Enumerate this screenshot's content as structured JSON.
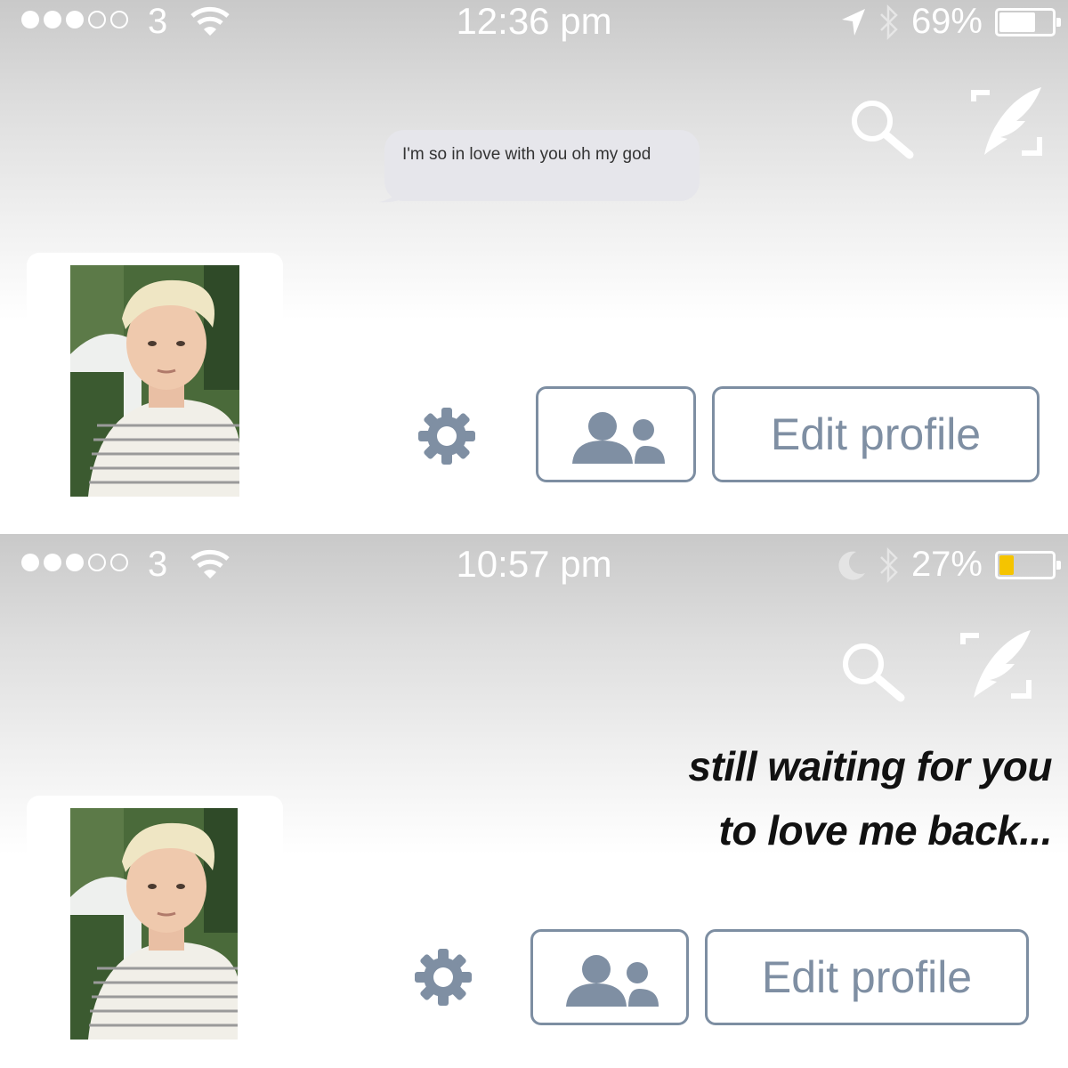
{
  "screens": [
    {
      "status": {
        "carrier": "3",
        "time": "12:36 pm",
        "battery_percent": "69%",
        "battery_level": 0.69,
        "battery_color": "#ffffff",
        "signal_bars": 3,
        "left_indicator": "location-arrow-icon"
      },
      "message": "I'm so in love with you oh my god",
      "buttons": {
        "edit_profile": "Edit profile"
      }
    },
    {
      "status": {
        "carrier": "3",
        "time": "10:57 pm",
        "battery_percent": "27%",
        "battery_level": 0.27,
        "battery_color": "#f5c400",
        "signal_bars": 3,
        "left_indicator": "moon-icon"
      },
      "caption": {
        "line1": "still waiting for you",
        "line2": "to love me back..."
      },
      "buttons": {
        "edit_profile": "Edit profile"
      }
    }
  ],
  "icons": {
    "search": "search-icon",
    "compose": "compose-feather-icon",
    "settings": "gear-icon",
    "friends": "people-icon",
    "wifi": "wifi-icon",
    "bluetooth": "bluetooth-icon"
  },
  "colors": {
    "button_outline": "#7d8ea2",
    "button_text": "#7f8fa3",
    "bubble": "#e6e6eb"
  }
}
